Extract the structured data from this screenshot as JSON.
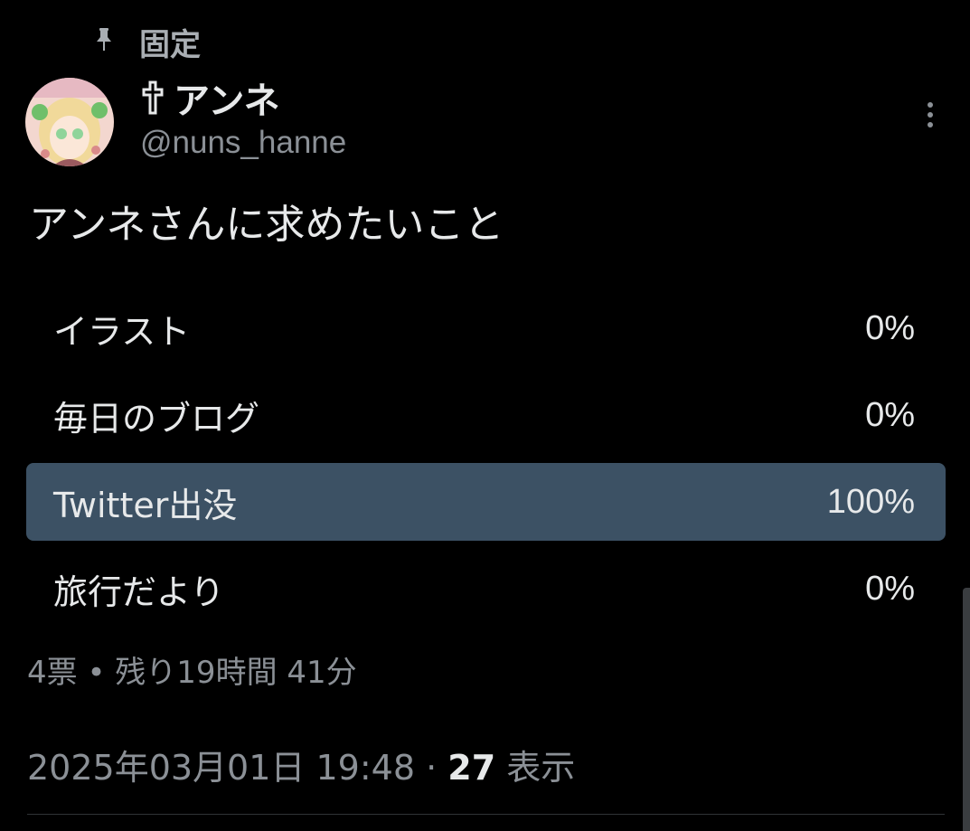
{
  "pinned": {
    "label": "固定",
    "icon": "pin-icon"
  },
  "author": {
    "display_name": "アンネ",
    "name_icon": "cross-icon",
    "handle": "@nuns_hanne"
  },
  "tweet": {
    "text": "アンネさんに求めたいこと"
  },
  "poll": {
    "options": [
      {
        "label": "イラスト",
        "percent": "0%"
      },
      {
        "label": "毎日のブログ",
        "percent": "0%"
      },
      {
        "label": "Twitter出没",
        "percent": "100%"
      },
      {
        "label": "旅行だより",
        "percent": "0%"
      }
    ],
    "summary": "4票 • 残り19時間 41分"
  },
  "meta": {
    "timestamp": "2025年03月01日 19:48",
    "separator": " · ",
    "views_count": "27",
    "views_label": " 表示"
  },
  "colors": {
    "background": "#000000",
    "winner_bar": "#3c5164",
    "primary_text": "#e7e9ea",
    "secondary_text": "#8b9096"
  }
}
